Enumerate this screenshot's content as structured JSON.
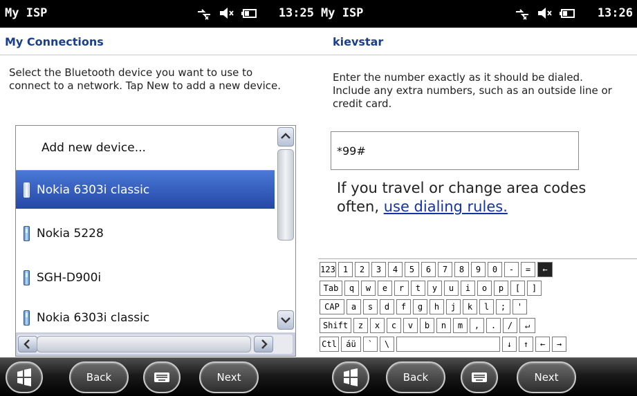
{
  "left": {
    "status": {
      "title": "My ISP",
      "time": ""
    },
    "header": {
      "title": "My Connections"
    },
    "description": "Select the Bluetooth device you want to use to connect to a network. Tap New to add a new device.",
    "devices": [
      {
        "label": "Add new device...",
        "icon": "",
        "selected": false
      },
      {
        "label": "Nokia 6303i classic",
        "icon": "phone-icon",
        "selected": true
      },
      {
        "label": "Nokia 5228",
        "icon": "phone-icon",
        "selected": false
      },
      {
        "label": "SGH-D900i",
        "icon": "phone-icon",
        "selected": false
      },
      {
        "label": "Nokia 6303i classic",
        "icon": "phone-icon",
        "selected": false
      }
    ],
    "bottom": {
      "back": "Back",
      "next": "Next"
    }
  },
  "right": {
    "status": {
      "title": "My ISP",
      "time": "13:26"
    },
    "header": {
      "title": "kievstar"
    },
    "description": "Enter the number exactly as it should be dialed.  Include any extra numbers, such as an outside line or credit card.",
    "phone_number": "*99#",
    "dial_text": "If you travel or change area codes often, ",
    "dial_link": "use dialing rules.",
    "bottom": {
      "back": "Back",
      "next": "Next"
    },
    "keyboard": {
      "row1": [
        "123",
        "1",
        "2",
        "3",
        "4",
        "5",
        "6",
        "7",
        "8",
        "9",
        "0",
        "-",
        "=",
        "←"
      ],
      "row2": [
        "Tab",
        "q",
        "w",
        "e",
        "r",
        "t",
        "y",
        "u",
        "i",
        "o",
        "p",
        "[",
        "]"
      ],
      "row3": [
        "CAP",
        "a",
        "s",
        "d",
        "f",
        "g",
        "h",
        "j",
        "k",
        "l",
        ";",
        "'"
      ],
      "row4": [
        "Shift",
        "z",
        "x",
        "c",
        "v",
        "b",
        "n",
        "m",
        ",",
        ".",
        "/",
        "↵"
      ],
      "row5": [
        "Ctl",
        "áü",
        "`",
        "\\",
        "",
        "↓",
        "↑",
        "←",
        "→"
      ]
    }
  },
  "left_time": "13:25",
  "colors": {
    "header_text": "#1b3f88",
    "selection": "#2f55b8",
    "link": "#1232a8"
  }
}
